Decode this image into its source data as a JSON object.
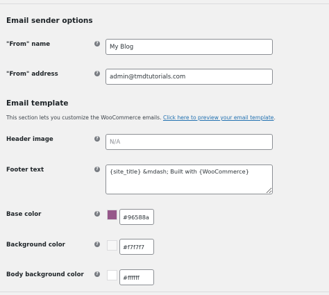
{
  "sender_section": {
    "title": "Email sender options",
    "from_name": {
      "label": "\"From\" name",
      "value": "My Blog"
    },
    "from_address": {
      "label": "\"From\" address",
      "value": "admin@tmdtutorials.com"
    }
  },
  "template_section": {
    "title": "Email template",
    "description": "This section lets you customize the WooCommerce emails.",
    "preview_link": "Click here to preview your email template",
    "description_end": ".",
    "header_image": {
      "label": "Header image",
      "placeholder": "N/A",
      "value": ""
    },
    "footer_text": {
      "label": "Footer text",
      "value": "{site_title} &mdash; Built with {WooCommerce}"
    },
    "base_color": {
      "label": "Base color",
      "value": "#96588a",
      "swatch": "#96588a"
    },
    "background_color": {
      "label": "Background color",
      "value": "#f7f7f7",
      "swatch": "#f7f7f7"
    },
    "body_background_color": {
      "label": "Body background color",
      "value": "#ffffff",
      "swatch": "#ffffff"
    }
  },
  "help_icon_glyph": "?",
  "colors": {
    "link": "#2271b1",
    "page_bg": "#f1f1f1",
    "border": "#8c8f94"
  }
}
